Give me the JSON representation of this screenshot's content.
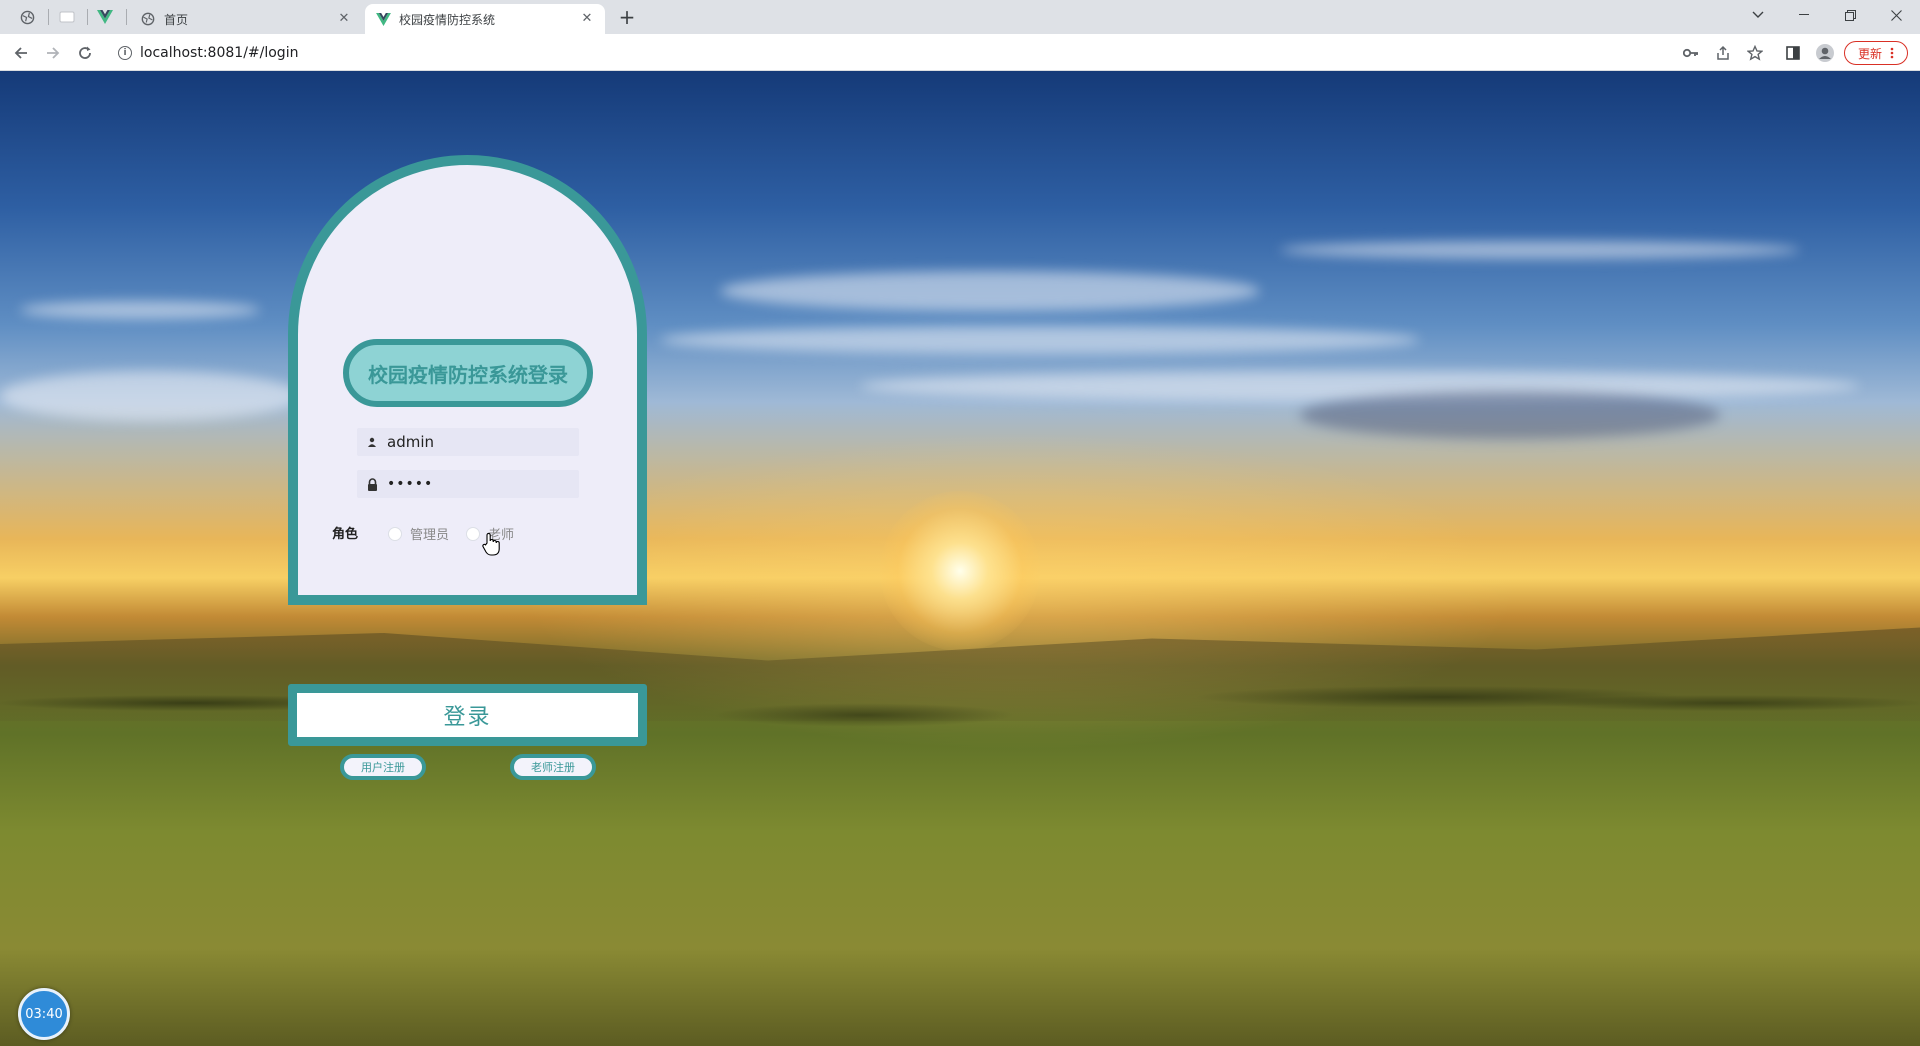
{
  "browser": {
    "tabs": [
      {
        "title": "首页",
        "active": false
      },
      {
        "title": "校园疫情防控系统",
        "active": true
      }
    ],
    "new_tab": "+",
    "url": "localhost:8081/#/login",
    "update_label": "更新"
  },
  "login": {
    "title": "校园疫情防控系统登录",
    "username": "admin",
    "password": "•••••",
    "role_label": "角色",
    "roles": [
      "管理员",
      "老师"
    ],
    "submit_label": "登录",
    "register_user": "用户注册",
    "register_teacher": "老师注册"
  },
  "timer": "03:40",
  "colors": {
    "accent": "#3a9898",
    "title_bg": "#8ed3d4",
    "card_bg": "#eeedf9",
    "update_red": "#d93025"
  }
}
